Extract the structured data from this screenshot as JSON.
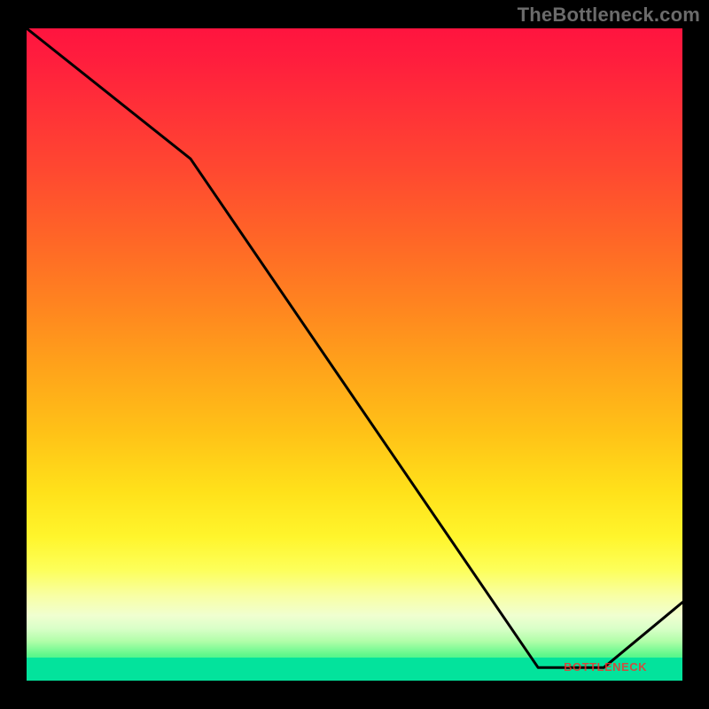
{
  "attribution": "TheBottleneck.com",
  "watermark": "BOTTLENECK",
  "colors": {
    "background": "#000000",
    "curve": "#000000",
    "attribution_text": "#6b6b6b",
    "watermark_text": "#ff2a2a",
    "gradient_top": "#ff143f",
    "gradient_bottom": "#00e39c"
  },
  "chart_data": {
    "type": "line",
    "title": "",
    "xlabel": "",
    "ylabel": "",
    "xlim": [
      0,
      100
    ],
    "ylim": [
      0,
      100
    ],
    "x": [
      0,
      25,
      78,
      88,
      100
    ],
    "values": [
      100,
      80,
      2,
      2,
      12
    ],
    "notes": "y appears to represent bottleneck percentage; background gradient encodes severity (red=high, green=low); optimum (minimum y) occurs around x≈78–88."
  }
}
